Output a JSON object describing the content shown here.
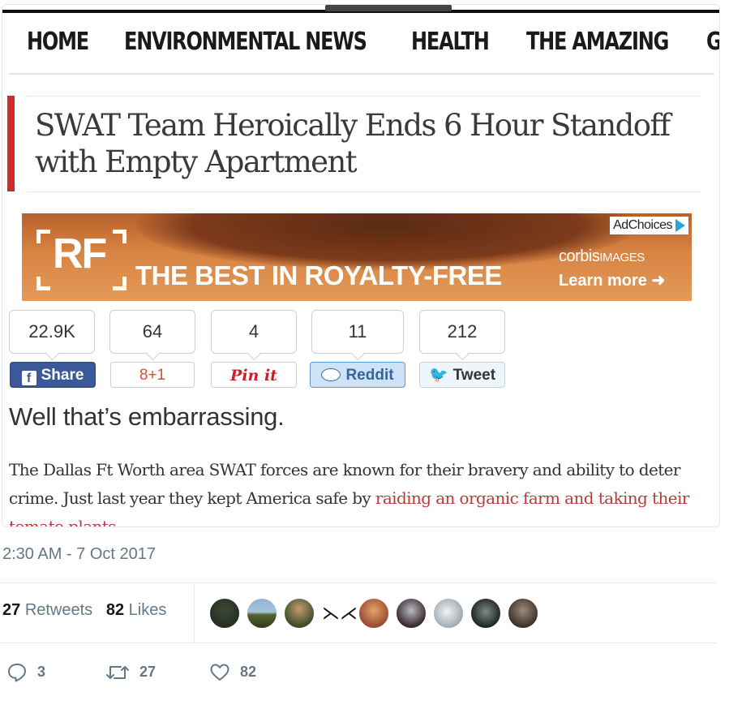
{
  "nav": {
    "items": [
      "HOME",
      "ENVIRONMENTAL NEWS",
      "HEALTH",
      "THE AMAZING",
      "G"
    ]
  },
  "article": {
    "headline_line1": "SWAT Team Heroically Ends 6 Hour Standoff",
    "headline_line2": "with Empty Apartment",
    "subhead": "Well that’s embarrassing.",
    "body_plain": "The Dallas Ft Worth area SWAT forces are known for their bravery and ability to deter crime. Just last year they kept America safe by ",
    "body_link": "raiding an organic farm and taking their tomato plants.",
    "link_color": "#b83a3a",
    "accent_color": "#d02a2a"
  },
  "ad": {
    "logo": "RF",
    "tagline": "THE BEST IN ROYALTY-FREE",
    "adchoices": "AdChoices",
    "brand": "corbis",
    "brand_suffix": "IMAGES",
    "learn_more": "Learn more"
  },
  "share": {
    "counts": [
      "22.9K",
      "64",
      "4",
      "11",
      "212"
    ],
    "buttons": {
      "facebook": "Share",
      "gplus": "+1",
      "gplus_glyph": "8",
      "pinterest": "Pin it",
      "reddit": "Reddit",
      "twitter": "Tweet"
    },
    "colors": {
      "facebook": "#3b5998",
      "gplus": "#dd4b39",
      "pinterest": "#cb2027",
      "reddit": "#cee3f8",
      "twitter": "#1da1f2"
    }
  },
  "tweet": {
    "timestamp": "2:30 AM - 7 Oct 2017",
    "retweets_count": "27",
    "retweets_label": "Retweets",
    "likes_count": "82",
    "likes_label": "Likes",
    "actions": {
      "replies": "3",
      "retweets": "27",
      "likes": "82"
    },
    "meta_color": "#657786"
  }
}
